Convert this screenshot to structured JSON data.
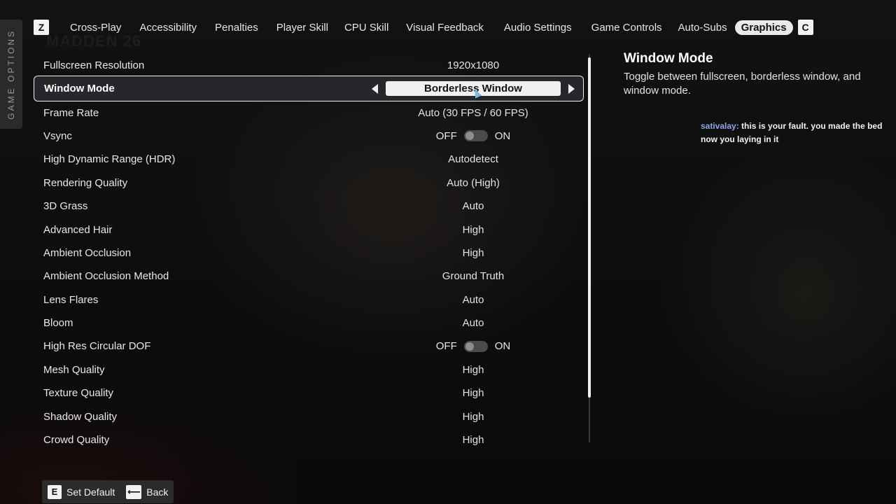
{
  "side_tab": {
    "label": "GAME OPTIONS"
  },
  "watermark": {
    "text": "MADDEN 26"
  },
  "topnav": {
    "left_key": "Z",
    "right_key": "C",
    "tabs": [
      {
        "label": "Cross-Play"
      },
      {
        "label": "Accessibility"
      },
      {
        "label": "Penalties"
      },
      {
        "label": "Player Skill"
      },
      {
        "label": "CPU Skill"
      },
      {
        "label": "Visual Feedback"
      },
      {
        "label": "Audio Settings"
      },
      {
        "label": "Game Controls"
      },
      {
        "label": "Auto-Subs"
      },
      {
        "label": "Graphics",
        "active": true
      }
    ]
  },
  "settings": [
    {
      "label": "Fullscreen Resolution",
      "value": "1920x1080"
    },
    {
      "label": "Window Mode",
      "value": "Borderless Window"
    },
    {
      "label": "Frame Rate",
      "value": "Auto (30 FPS / 60 FPS)"
    },
    {
      "label": "Vsync",
      "off": "OFF",
      "on": "ON"
    },
    {
      "label": "High Dynamic Range (HDR)",
      "value": "Autodetect"
    },
    {
      "label": "Rendering Quality",
      "value": "Auto (High)"
    },
    {
      "label": "3D Grass",
      "value": "Auto"
    },
    {
      "label": "Advanced Hair",
      "value": "High"
    },
    {
      "label": "Ambient Occlusion",
      "value": "High"
    },
    {
      "label": "Ambient Occlusion Method",
      "value": "Ground Truth"
    },
    {
      "label": "Lens Flares",
      "value": "Auto"
    },
    {
      "label": "Bloom",
      "value": "Auto"
    },
    {
      "label": "High Res Circular DOF",
      "off": "OFF",
      "on": "ON"
    },
    {
      "label": "Mesh Quality",
      "value": "High"
    },
    {
      "label": "Texture Quality",
      "value": "High"
    },
    {
      "label": "Shadow Quality",
      "value": "High"
    },
    {
      "label": "Crowd Quality",
      "value": "High"
    }
  ],
  "info": {
    "title": "Window Mode",
    "description": "Toggle between fullscreen, borderless window, and window mode."
  },
  "chat": {
    "user": "sativalay:",
    "message": "this is your fault. you made the bed now you laying in it"
  },
  "footer": {
    "set_default_key": "E",
    "set_default_label": "Set Default",
    "back_key": "⟵",
    "back_label": "Back"
  }
}
